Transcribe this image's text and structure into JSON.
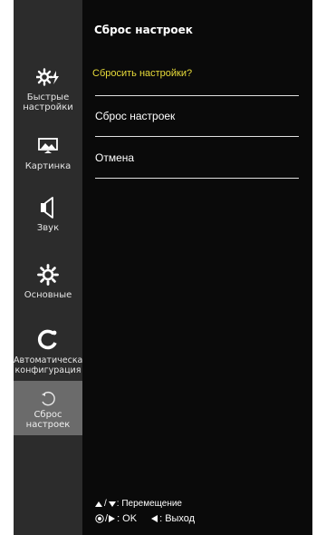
{
  "sidebar": {
    "items": [
      {
        "label": "Быстрые настройки",
        "icon": "quick-settings-icon",
        "active": false
      },
      {
        "label": "Картинка",
        "icon": "picture-icon",
        "active": false
      },
      {
        "label": "Звук",
        "icon": "speaker-icon",
        "active": false
      },
      {
        "label": "Основные",
        "icon": "gear-icon",
        "active": false
      },
      {
        "label": "Автоматическая конфигурация",
        "icon": "auto-config-icon",
        "active": false
      },
      {
        "label": "Сброс настроек",
        "icon": "reset-icon",
        "active": true
      }
    ]
  },
  "main": {
    "title": "Сброс настроек",
    "question": "Сбросить настройки?",
    "options": [
      {
        "label": "Сброс настроек"
      },
      {
        "label": "Отмена"
      }
    ]
  },
  "footer": {
    "move_label": ": Перемещение",
    "ok_label": ": OK",
    "exit_label": ": Выход"
  },
  "colors": {
    "background": "#000000",
    "sidebar": "#2c2c2c",
    "active_item": "#6b6b6b",
    "question_text": "#e8dc3a"
  }
}
